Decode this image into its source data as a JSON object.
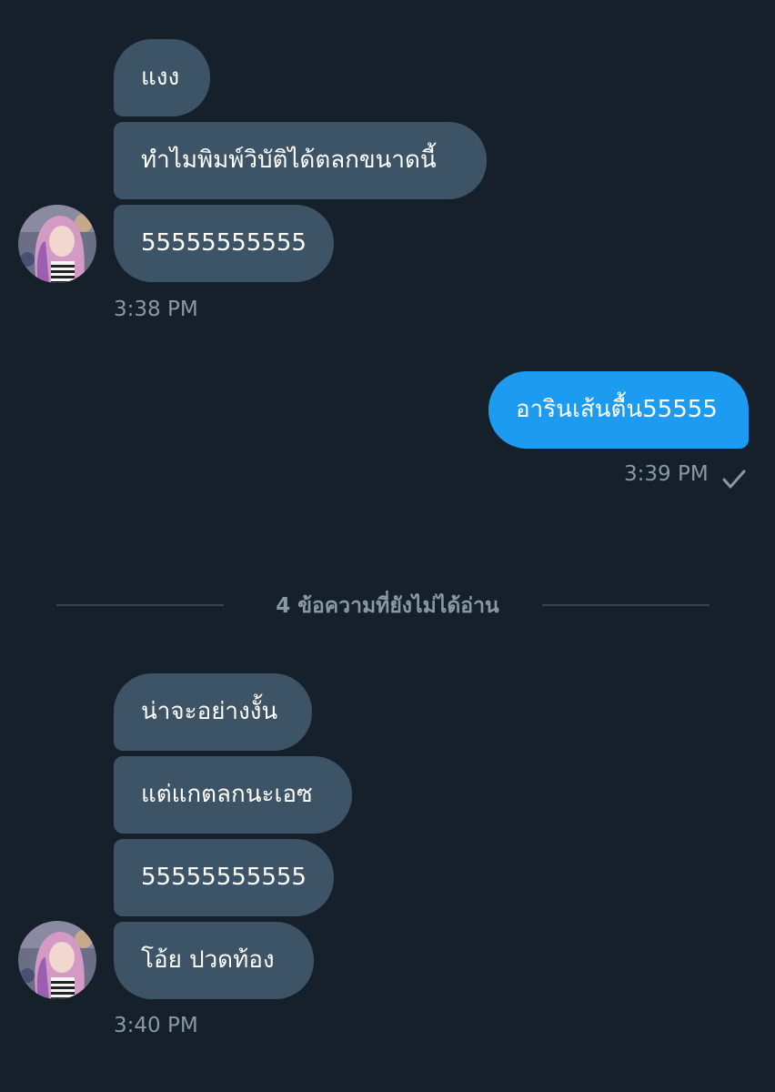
{
  "colors": {
    "background": "#15202b",
    "incoming_bubble": "#3d5466",
    "outgoing_bubble": "#1d9bf0",
    "timestamp": "#8899a6",
    "divider": "#38444d"
  },
  "group1": {
    "messages": [
      "แงง",
      "ทำไมพิมพ์วิบัติได้ตลกขนาดนี้",
      "55555555555"
    ],
    "time": "3:38 PM"
  },
  "outgoing": {
    "message": "อารินเส้นตื้น55555",
    "time": "3:39 PM",
    "status_icon": "checkmark-icon"
  },
  "divider": {
    "text": "4 ข้อความที่ยังไม่ได้อ่าน"
  },
  "group2": {
    "messages": [
      "น่าจะอย่างงั้น",
      "แต่แกตลกนะเอซ",
      "55555555555",
      "โอ้ย ปวดท้อง"
    ],
    "time": "3:40 PM"
  },
  "avatar_icon": "user-avatar"
}
